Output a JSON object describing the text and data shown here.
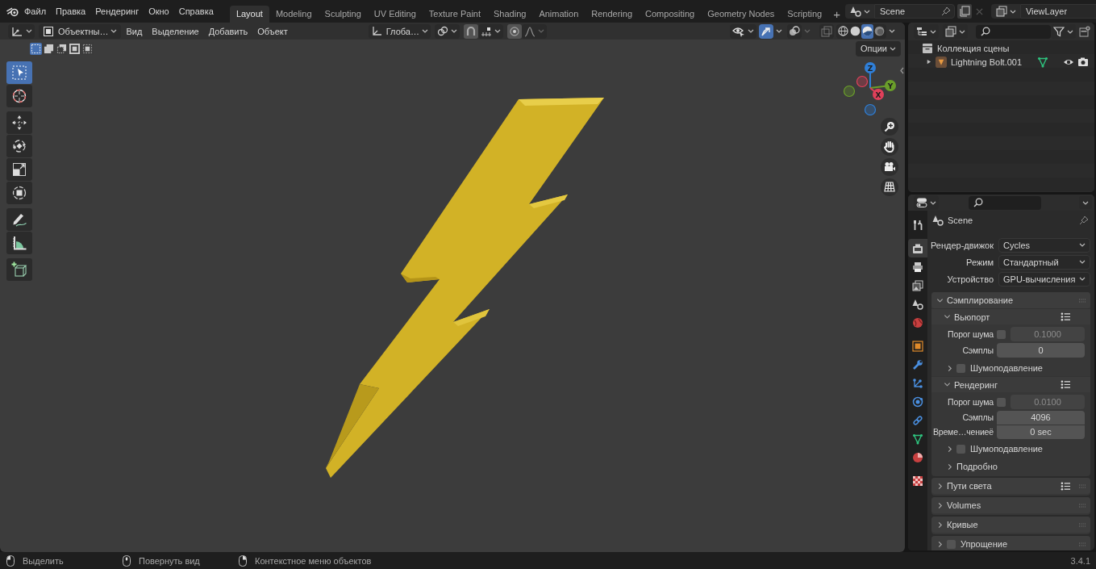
{
  "top_bar": {
    "menus": [
      "Файл",
      "Правка",
      "Рендеринг",
      "Окно",
      "Справка"
    ],
    "workspaces": [
      {
        "label": "Layout",
        "selected": true
      },
      {
        "label": "Modeling",
        "selected": false
      },
      {
        "label": "Sculpting",
        "selected": false
      },
      {
        "label": "UV Editing",
        "selected": false
      },
      {
        "label": "Texture Paint",
        "selected": false
      },
      {
        "label": "Shading",
        "selected": false
      },
      {
        "label": "Animation",
        "selected": false
      },
      {
        "label": "Rendering",
        "selected": false
      },
      {
        "label": "Compositing",
        "selected": false
      },
      {
        "label": "Geometry Nodes",
        "selected": false
      },
      {
        "label": "Scripting",
        "selected": false
      }
    ],
    "add_workspace": "+",
    "scene": "Scene",
    "view_layer": "ViewLayer"
  },
  "viewport": {
    "mode": "Объектны…",
    "menus": [
      "Вид",
      "Выделение",
      "Добавить",
      "Объект"
    ],
    "orientation": "Глоба…",
    "toggles": [
      {
        "kind": "gizmos",
        "on": true
      },
      {
        "kind": "overlays",
        "on": false
      },
      {
        "kind": "xray",
        "on": false
      }
    ],
    "shading": [
      {
        "kind": "wireframe",
        "selected": false
      },
      {
        "kind": "solid",
        "selected": false
      },
      {
        "kind": "material",
        "selected": true
      },
      {
        "kind": "rendered",
        "selected": false
      }
    ],
    "select_modes": [
      {
        "kind": "set",
        "selected": true
      },
      {
        "kind": "extend",
        "selected": false
      },
      {
        "kind": "subtract",
        "selected": false
      },
      {
        "kind": "invert",
        "selected": false
      },
      {
        "kind": "intersect",
        "selected": false
      }
    ],
    "options": "Опции",
    "tool_groups": [
      {
        "tools": [
          {
            "kind": "select_box",
            "selected": true
          },
          {
            "kind": "cursor",
            "selected": false
          }
        ]
      },
      {
        "tools": [
          {
            "kind": "move",
            "selected": false
          },
          {
            "kind": "rotate",
            "selected": false
          },
          {
            "kind": "scale",
            "selected": false
          },
          {
            "kind": "transform",
            "selected": false
          }
        ]
      },
      {
        "tools": [
          {
            "kind": "annotate",
            "selected": false
          },
          {
            "kind": "measure",
            "selected": false
          }
        ]
      },
      {
        "tools": [
          {
            "kind": "add_cube",
            "selected": false
          }
        ]
      }
    ],
    "axes": [
      {
        "label": "Z",
        "color": "#2f7fd8"
      },
      {
        "label": "Y",
        "color": "#6a9e2a"
      },
      {
        "label": "X",
        "color": "#e0405a"
      }
    ]
  },
  "outliner": {
    "collection": "Коллекция сцены",
    "items": [
      {
        "name": "Lightning Bolt.001",
        "expanded": false
      }
    ]
  },
  "properties": {
    "tab_groups": [
      {
        "tabs": [
          {
            "kind": "tool",
            "selected": false
          }
        ]
      },
      {
        "tabs": [
          {
            "kind": "render",
            "selected": true
          },
          {
            "kind": "output",
            "selected": false
          },
          {
            "kind": "view_layer",
            "selected": false
          },
          {
            "kind": "scene",
            "selected": false
          },
          {
            "kind": "world",
            "selected": false
          }
        ]
      },
      {
        "tabs": [
          {
            "kind": "object",
            "selected": false
          },
          {
            "kind": "modifiers",
            "selected": false
          },
          {
            "kind": "particles",
            "selected": false
          },
          {
            "kind": "physics",
            "selected": false
          },
          {
            "kind": "constraints",
            "selected": false
          },
          {
            "kind": "data",
            "selected": false
          },
          {
            "kind": "material",
            "selected": false
          }
        ]
      },
      {
        "tabs": [
          {
            "kind": "texture",
            "selected": false
          }
        ]
      }
    ],
    "context": "Scene",
    "fields": [
      {
        "label": "Рендер-движок",
        "value": "Cycles"
      },
      {
        "label": "Режим",
        "value": "Стандартный"
      },
      {
        "label": "Устройство",
        "value": "GPU-вычисления"
      }
    ],
    "panels": [
      {
        "title": "Сэмплирование",
        "expanded": true,
        "children": [
          {
            "title": "Вьюпорт",
            "expanded": true,
            "presets": true,
            "rows": [
              {
                "kind": "check_number",
                "label": "Порог шума",
                "checked": false,
                "value": "0.1000"
              },
              {
                "kind": "number",
                "label": "Сэмплы",
                "value": "0"
              }
            ],
            "children": [
              {
                "title": "Шумоподавление",
                "expanded": false,
                "checked": false
              }
            ]
          },
          {
            "title": "Рендеринг",
            "expanded": true,
            "presets": true,
            "rows": [
              {
                "kind": "check_number",
                "label": "Порог шума",
                "checked": false,
                "value": "0.0100"
              },
              {
                "kind": "number",
                "label": "Сэмплы",
                "value": "4096"
              },
              {
                "kind": "number",
                "label": "Време…чениеё",
                "value": "0 sec"
              }
            ],
            "children": [
              {
                "title": "Шумоподавление",
                "expanded": false,
                "checked": false
              },
              {
                "title": "Подробно",
                "expanded": false
              }
            ]
          }
        ]
      },
      {
        "title": "Пути света",
        "expanded": false,
        "presets": true
      },
      {
        "title": "Volumes",
        "expanded": false
      },
      {
        "title": "Кривые",
        "expanded": false
      },
      {
        "title": "Упрощение",
        "expanded": false,
        "checked": false
      }
    ]
  },
  "status_bar": {
    "hints": [
      {
        "kind": "left",
        "label": "Выделить"
      },
      {
        "kind": "middle",
        "label": "Повернуть вид"
      },
      {
        "kind": "right",
        "label": "Контекстное меню объектов"
      }
    ],
    "version": "3.4.1"
  }
}
